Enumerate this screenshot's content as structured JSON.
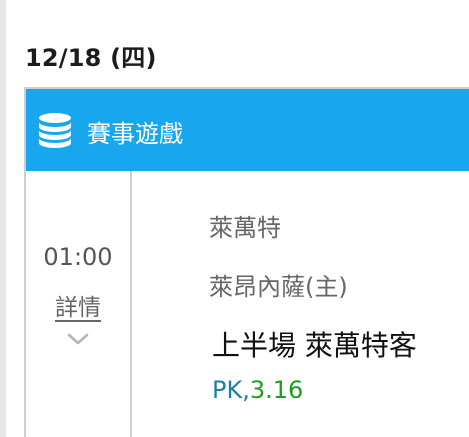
{
  "date_header": "12/18 (四)",
  "section": {
    "title": "賽事遊戲",
    "icon": "database-stack-icon"
  },
  "match": {
    "time": "01:00",
    "detail_label": "詳情",
    "expand_icon": "chevron-down-icon",
    "team_away": "萊萬特",
    "team_home": "萊昂內薩(主)",
    "bet_selection": "上半場 萊萬特客",
    "bet_type": "PK,",
    "odds": "3.16"
  },
  "colors": {
    "header_bg": "#18a7ef",
    "pk_color": "#1d7ea8",
    "odds_color": "#1e9d22"
  }
}
